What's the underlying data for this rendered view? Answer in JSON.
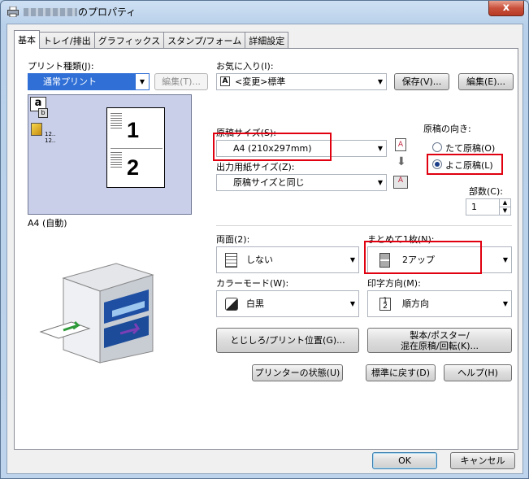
{
  "window": {
    "title_suffix": "のプロパティ",
    "close_label": "x"
  },
  "tabs": [
    "基本",
    "トレイ/排出",
    "グラフィックス",
    "スタンプ/フォーム",
    "詳細設定"
  ],
  "print_type": {
    "label": "プリント種類(J):",
    "value": "通常プリント"
  },
  "edit_disabled": "編集(T)...",
  "favorites": {
    "label": "お気に入り(I):",
    "value": "<変更>標準",
    "save_label": "保存(V)...",
    "edit_label": "編集(E)..."
  },
  "preview": {
    "page1": "1",
    "page2": "2",
    "caption": "A4 (自動)",
    "thumb_text1": "12..",
    "thumb_text2": "12.."
  },
  "original_size": {
    "label": "原稿サイズ(S):",
    "value": "A4 (210x297mm)"
  },
  "output_size": {
    "label": "出力用紙サイズ(Z):",
    "value": "原稿サイズと同じ"
  },
  "orientation": {
    "label": "原稿の向き:",
    "portrait": "たて原稿(O)",
    "landscape": "よこ原稿(L)",
    "selected": "landscape"
  },
  "copies": {
    "label": "部数(C):",
    "value": "1"
  },
  "duplex": {
    "label": "両面(2):",
    "value": "しない"
  },
  "nup": {
    "label": "まとめて1枚(N):",
    "value": "2アップ"
  },
  "color_mode": {
    "label": "カラーモード(W):",
    "value": "白黒"
  },
  "print_direction": {
    "label": "印字方向(M):",
    "value": "順方向"
  },
  "buttons": {
    "binding": "とじしろ/プリント位置(G)...",
    "booklet_line1": "製本/ポスター/",
    "booklet_line2": "混在原稿/回転(K)...",
    "printer_status": "プリンターの状態(U)",
    "restore_defaults": "標準に戻す(D)",
    "help": "ヘルプ(H)",
    "ok": "OK",
    "cancel": "キャンセル"
  },
  "colors": {
    "highlight_red": "#e0000f",
    "selected_blue": "#2a6fd3"
  }
}
